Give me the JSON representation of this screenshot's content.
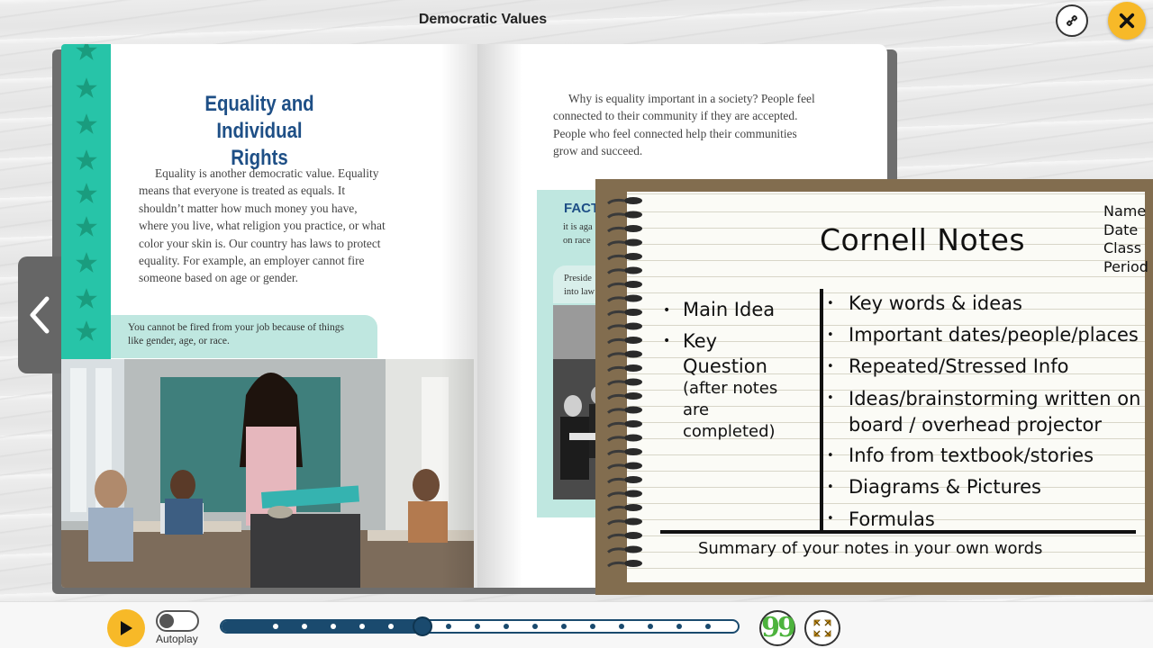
{
  "header": {
    "title": "Democratic Values"
  },
  "left_page": {
    "chapter_title_line1": "Equality and",
    "chapter_title_line2": "Individual Rights",
    "paragraph": [
      "Equality is another democratic value. Equality",
      "means that everyone is treated as equals. It",
      "shouldn’t matter how much money you have,",
      "where you live, what religion you practice, or what",
      "color your skin is. Our country has laws to protect",
      "equality. For example, an employer cannot fire",
      "someone based on age or gender."
    ],
    "caption_line1": "You cannot be fired from your job because of things",
    "caption_line2": "like gender, age, or race."
  },
  "right_page": {
    "paragraph": [
      "Why is equality important in a society? People feel",
      "connected to their community if they are accepted.",
      "People who feel connected help their communities",
      "grow and succeed."
    ],
    "fact_title": "FACT",
    "fact_line1": "it is aga",
    "fact_line2": "on race",
    "pres_line1": "Preside",
    "pres_line2": "into law"
  },
  "cornell_notes": {
    "heading": "Cornell Notes",
    "meta": [
      "Name",
      "Date",
      "Class",
      "Period"
    ],
    "cues": {
      "main_idea": "Main Idea",
      "key": "Key",
      "question": "Question",
      "after1": "(after notes",
      "after2": "are",
      "after3": "completed)"
    },
    "notes": [
      "Key words & ideas",
      "Important dates/people/places",
      "Repeated/Stressed Info",
      "Ideas/brainstorming written on",
      "Info from textbook/stories",
      "Diagrams & Pictures",
      "Formulas"
    ],
    "notes_cont": "board / overhead projector",
    "summary": "Summary of your notes in your own words"
  },
  "player": {
    "autoplay_label": "Autoplay",
    "autoplay_on": false,
    "progress_fraction": 0.39,
    "quote_glyph": "99"
  },
  "colors": {
    "accent_yellow": "#f7b928",
    "teal": "#27c4a8",
    "navy": "#1a4a6e",
    "title_blue": "#1e4f86",
    "quote_green": "#4db33d"
  }
}
